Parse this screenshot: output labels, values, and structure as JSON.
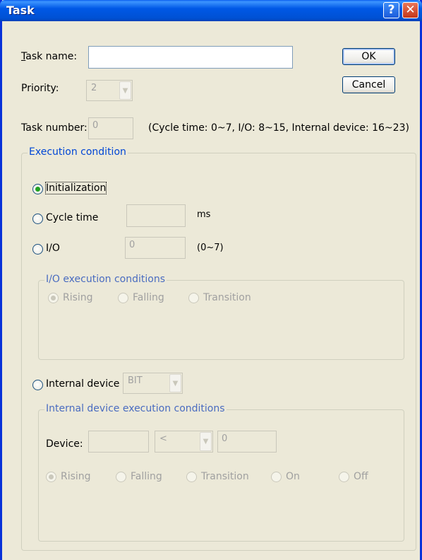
{
  "window": {
    "title": "Task",
    "help_label": "?",
    "close_label": "✕"
  },
  "task_name": {
    "label": "Task name:",
    "value": ""
  },
  "priority": {
    "label": "Priority:",
    "value": "2"
  },
  "task_number": {
    "label": "Task number:",
    "value": "0",
    "hint": "(Cycle time: 0~7, I/O: 8~15, Internal device: 16~23)"
  },
  "buttons": {
    "ok": "OK",
    "cancel": "Cancel"
  },
  "execution_condition": {
    "legend": "Execution condition",
    "initialization": {
      "label": "Initialization",
      "checked": true
    },
    "cycle_time": {
      "label": "Cycle time",
      "value": "",
      "unit": "ms"
    },
    "io": {
      "label": "I/O",
      "value": "0",
      "range": "(0~7)"
    },
    "io_conditions": {
      "legend": "I/O execution conditions",
      "options": [
        {
          "label": "Rising",
          "checked": true
        },
        {
          "label": "Falling",
          "checked": false
        },
        {
          "label": "Transition",
          "checked": false
        }
      ]
    },
    "internal_device": {
      "label": "Internal device",
      "value": "BIT"
    },
    "internal_conditions": {
      "legend": "Internal device execution conditions",
      "device_label": "Device:",
      "device_value": "",
      "operator_value": "<",
      "compare_value": "0",
      "options": [
        {
          "label": "Rising",
          "checked": true
        },
        {
          "label": "Falling",
          "checked": false
        },
        {
          "label": "Transition",
          "checked": false
        },
        {
          "label": "On",
          "checked": false
        },
        {
          "label": "Off",
          "checked": false
        }
      ]
    }
  },
  "icons": {
    "dropdown": "chevron-down-icon",
    "help": "help-icon",
    "close": "close-icon"
  },
  "colors": {
    "titlebar": "#0058E6",
    "dialog_bg": "#ECE9D8",
    "group_legend": "#0046D5",
    "radio_checked": "#21A121"
  }
}
